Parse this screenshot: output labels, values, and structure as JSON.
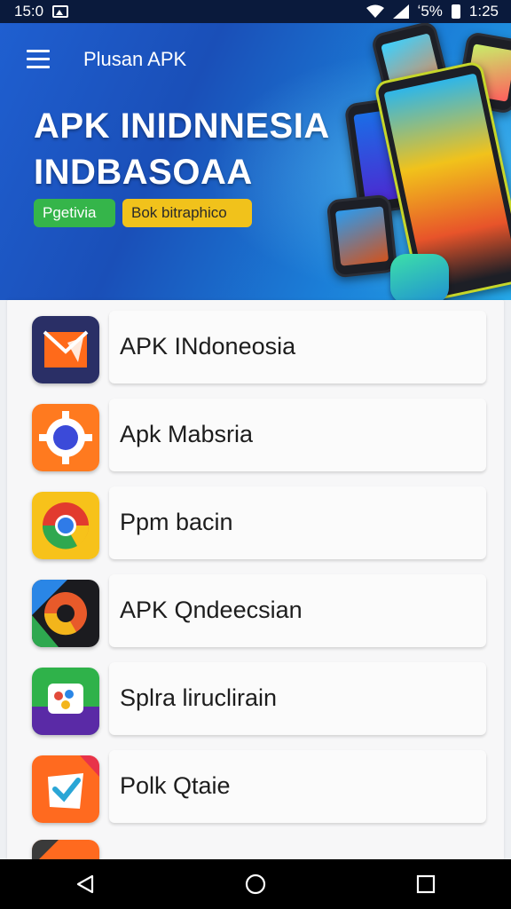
{
  "status_bar": {
    "time_left": "15:0",
    "battery_text": "ʻ5%",
    "time_right": "1:25"
  },
  "header": {
    "app_title": "Plusan APK",
    "hero_line1": "APK INIDNNESIA",
    "hero_line2": "INDBASOAA",
    "chip_green": "Pgetivia",
    "chip_yellow": "Bok bitraphico",
    "colors": {
      "banner": "#1f5fd0",
      "chip_green": "#35b54a",
      "chip_yellow": "#f1c21b"
    }
  },
  "apps": [
    {
      "name": "APK INdoneosia",
      "icon": "orange-envelope-icon"
    },
    {
      "name": "Apk Mabsria",
      "icon": "gear-orange-icon"
    },
    {
      "name": "Ppm bacin",
      "icon": "chrome-icon"
    },
    {
      "name": "APK Qndeecsian",
      "icon": "chrome-dark-icon"
    },
    {
      "name": "Splra liruclirain",
      "icon": "green-purple-app-icon"
    },
    {
      "name": "Polk Qtaie",
      "icon": "orange-check-icon"
    }
  ],
  "nav": [
    "back-icon",
    "home-icon",
    "recents-icon"
  ]
}
